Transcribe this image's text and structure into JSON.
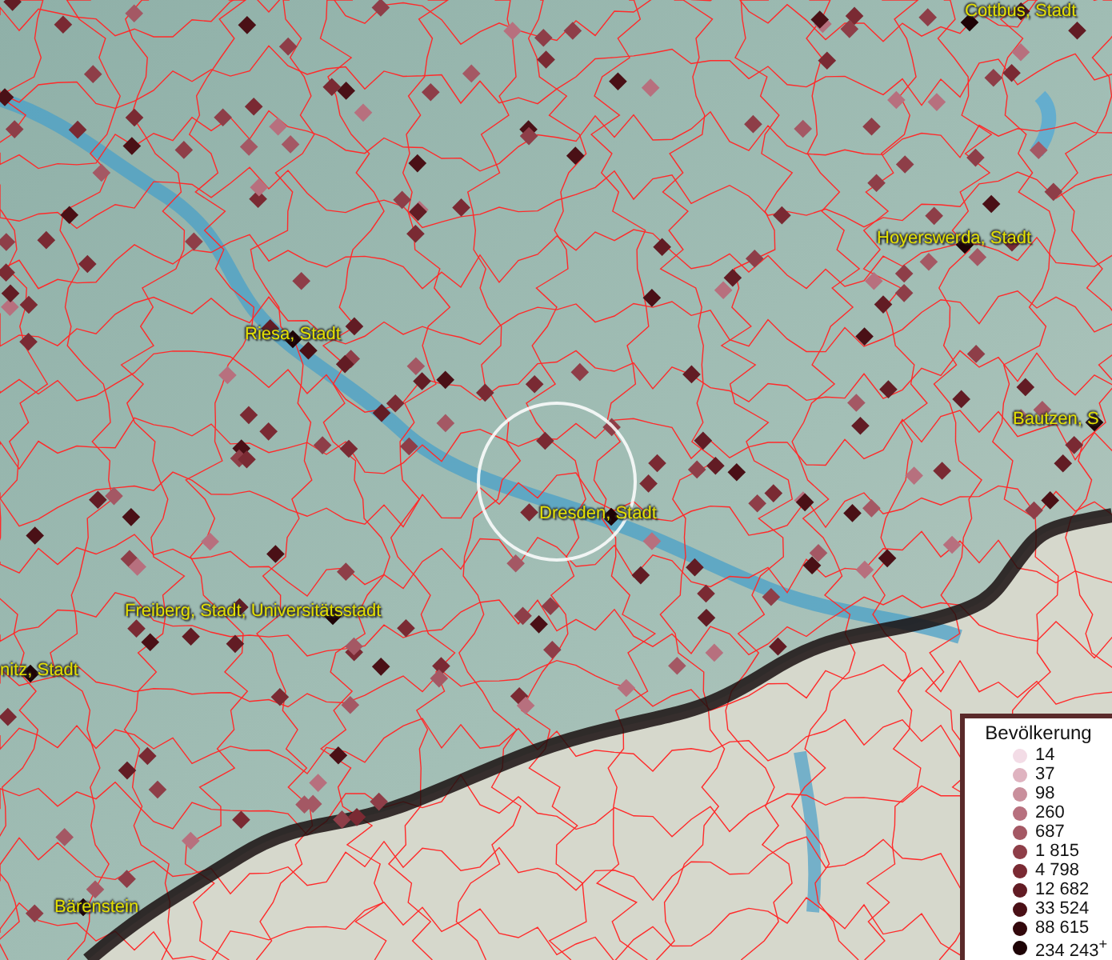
{
  "map": {
    "place_labels": [
      {
        "text": "Cottbus, Stadt"
      },
      {
        "text": "Hoyerswerda, Stadt"
      },
      {
        "text": "Riesa, Stadt"
      },
      {
        "text": "Bautzen, S"
      },
      {
        "text": "Dresden, Stadt"
      },
      {
        "text": "Freiberg, Stadt, Universitätsstadt"
      },
      {
        "text": "nitz, Stadt"
      },
      {
        "text": "Bärenstein"
      }
    ]
  },
  "legend": {
    "title": "Bevölkerung",
    "items": [
      {
        "label": "14",
        "color": "#f3dce6"
      },
      {
        "label": "37",
        "color": "#dfb3c0"
      },
      {
        "label": "98",
        "color": "#c98f9c"
      },
      {
        "label": "260",
        "color": "#b7707e"
      },
      {
        "label": "687",
        "color": "#a45864"
      },
      {
        "label": "1 815",
        "color": "#8e3e48"
      },
      {
        "label": "4 798",
        "color": "#7a2a33"
      },
      {
        "label": "12 682",
        "color": "#621c24"
      },
      {
        "label": "33 524",
        "color": "#4a1016"
      },
      {
        "label": "88 615",
        "color": "#33080c"
      },
      {
        "label": "234 243$^{+}$",
        "color": "#1e0306"
      }
    ]
  }
}
